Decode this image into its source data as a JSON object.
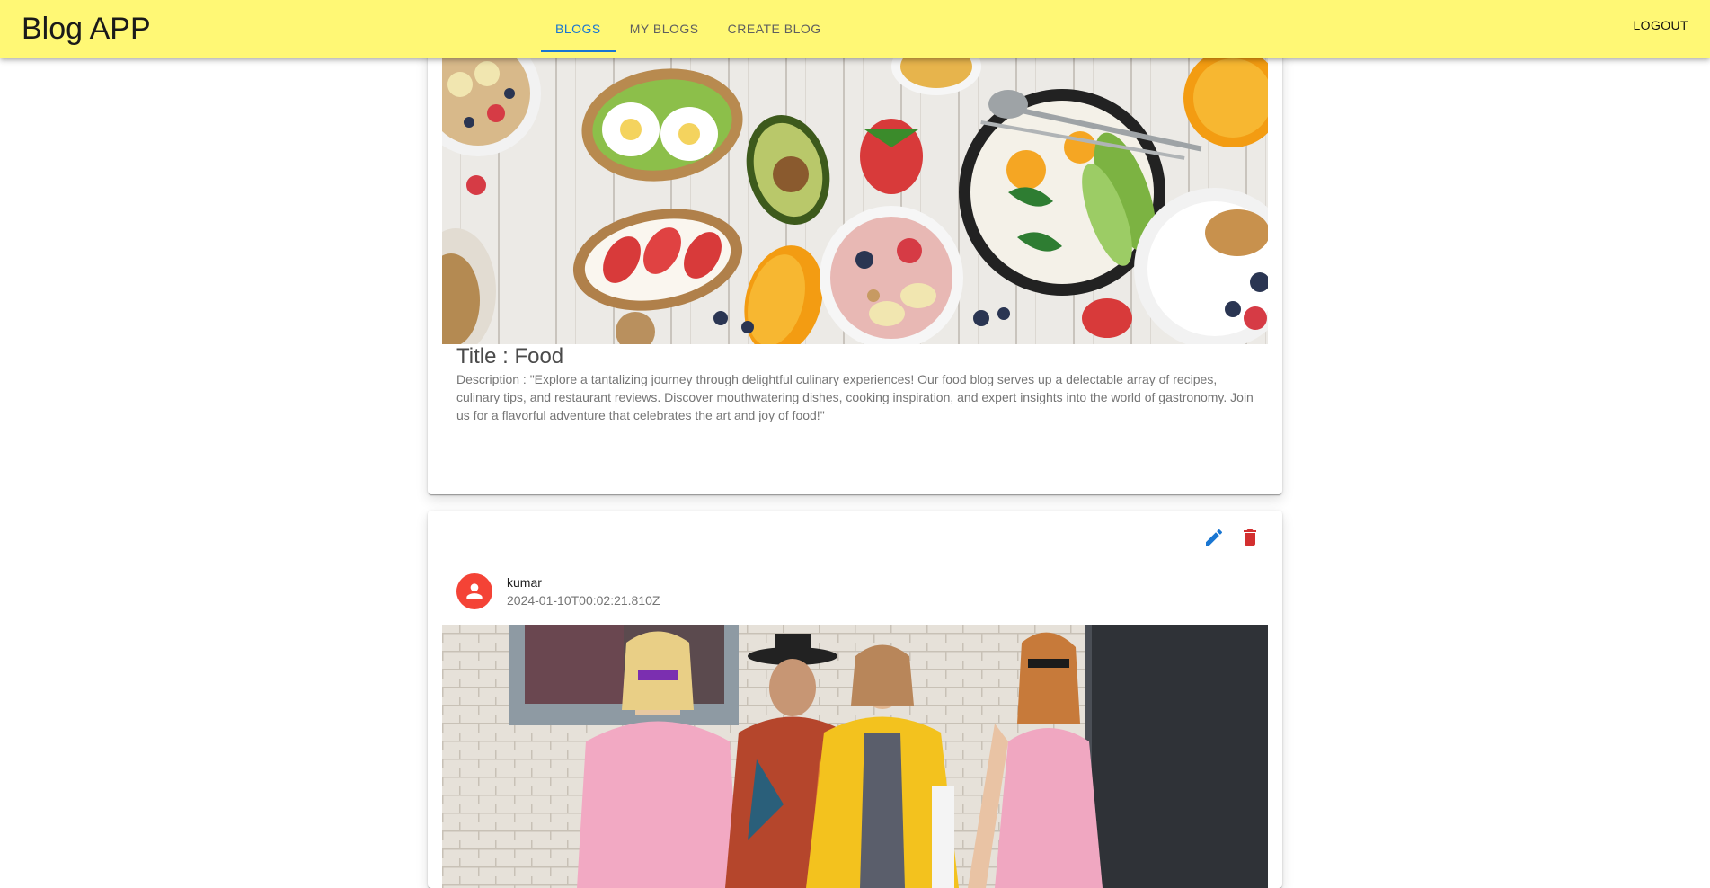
{
  "app": {
    "brand": "Blog APP",
    "tabs": [
      {
        "label": "BLOGS",
        "active": true
      },
      {
        "label": "MY BLOGS",
        "active": false
      },
      {
        "label": "CREATE BLOG",
        "active": false
      }
    ],
    "logout_label": "LOGOUT",
    "colors": {
      "appbar": "#fff875",
      "accent": "#1976d2",
      "avatar": "#f44336",
      "delete": "#d32f2f"
    }
  },
  "blogs": [
    {
      "title": "Title : Food",
      "description": "Description : \"Explore a tantalizing journey through delightful culinary experiences! Our food blog serves up a delectable array of recipes, culinary tips, and restaurant reviews. Discover mouthwatering dishes, cooking inspiration, and expert insights into the world of gastronomy. Join us for a flavorful adventure that celebrates the art and joy of food!\"",
      "image": "breakfast-spread-photo"
    },
    {
      "author": "kumar",
      "date": "2024-01-10T00:02:21.810Z",
      "image": "street-fashion-photo",
      "icons": {
        "edit": "edit-icon",
        "delete": "delete-icon",
        "avatar": "person-icon"
      }
    }
  ]
}
